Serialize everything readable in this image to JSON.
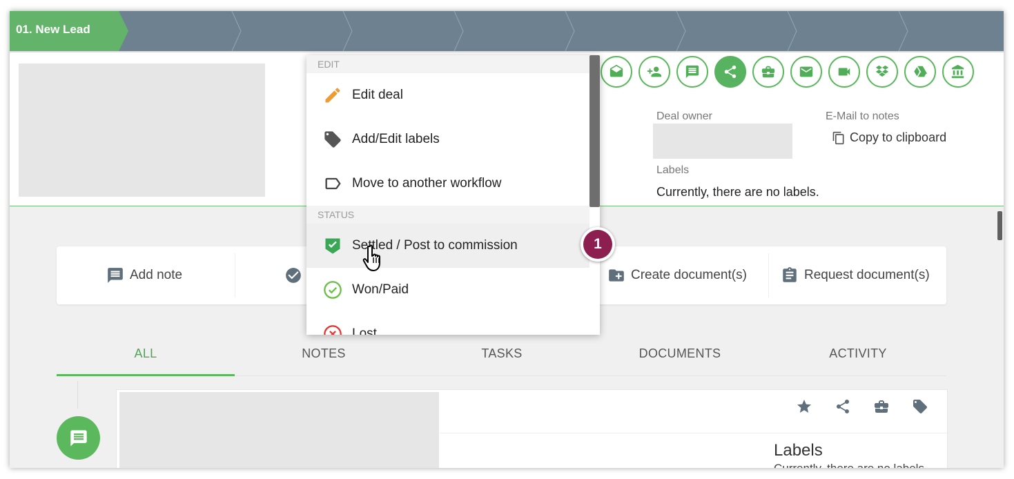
{
  "pipeline": {
    "active_stage": "01. New Lead",
    "stage_color_active": "#63b36b",
    "stage_color_inactive": "#6e8190"
  },
  "header": {
    "action_icons": [
      "envelope-open-icon",
      "add-person-icon",
      "comment-icon",
      "share-icon",
      "briefcase-icon",
      "mail-icon",
      "video-icon",
      "dropbox-icon",
      "google-drive-icon",
      "bank-icon"
    ],
    "active_icon": "share-icon",
    "deal_owner_label": "Deal owner",
    "email_to_notes_label": "E-Mail to notes",
    "copy_to_clipboard": "Copy to clipboard",
    "labels_label": "Labels",
    "no_labels_text": "Currently, there are no labels."
  },
  "actions": {
    "add_note": "Add note",
    "create_documents": "Create document(s)",
    "request_documents": "Request document(s)"
  },
  "tabs": [
    {
      "label": "ALL",
      "active": true
    },
    {
      "label": "NOTES",
      "active": false
    },
    {
      "label": "TASKS",
      "active": false
    },
    {
      "label": "DOCUMENTS",
      "active": false
    },
    {
      "label": "ACTIVITY",
      "active": false
    }
  ],
  "note_card": {
    "labels_title": "Labels",
    "labels_text": "Currently, there are no labels."
  },
  "dropdown": {
    "edit_section": "EDIT",
    "edit_deal": "Edit deal",
    "add_edit_labels": "Add/Edit labels",
    "move_workflow": "Move to another workflow",
    "status_section": "STATUS",
    "settled": "Settled / Post to commission",
    "won_paid": "Won/Paid",
    "lost": "Lost"
  },
  "step_badge": "1",
  "colors": {
    "accent_green": "#5cb85c",
    "badge": "#8c1f4f",
    "pencil": "#f29a2e",
    "lost_red": "#e53935"
  }
}
